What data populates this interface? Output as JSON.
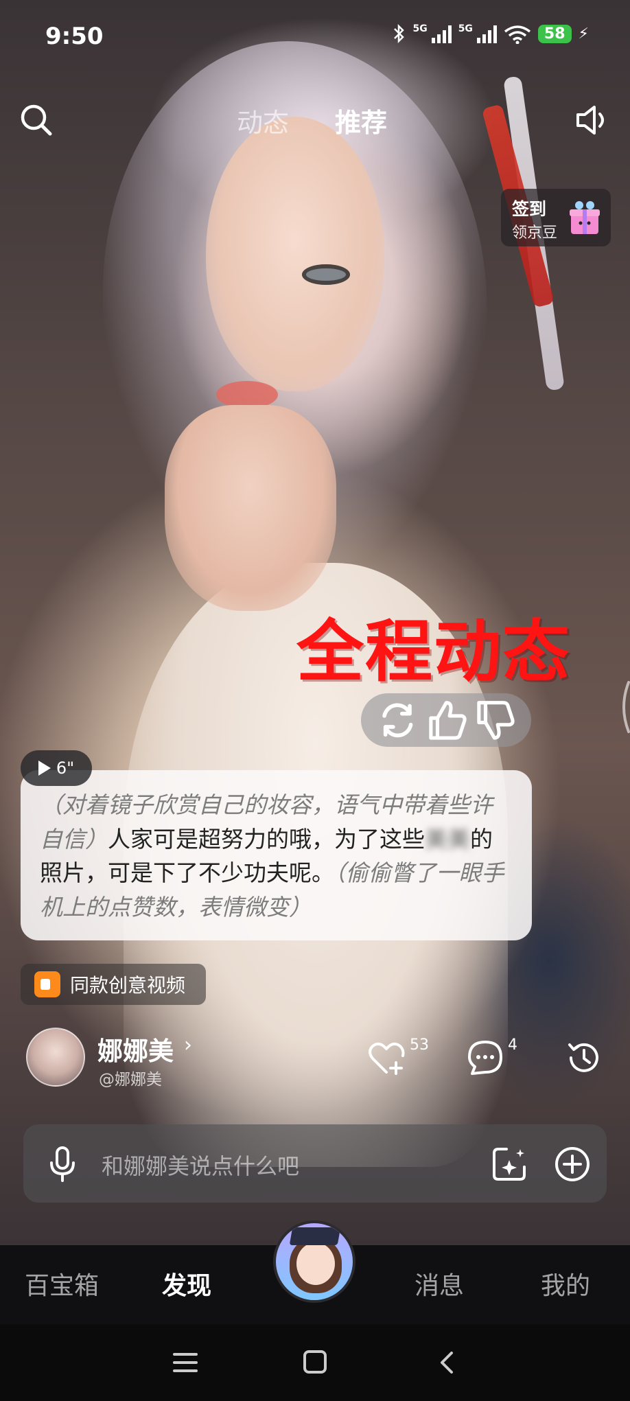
{
  "status_bar": {
    "time": "9:50",
    "network_1": "5G",
    "network_2": "5G",
    "battery": "58"
  },
  "top_tabs": {
    "dynamic": "动态",
    "recommend": "推荐"
  },
  "sign_in": {
    "title": "签到",
    "subtitle": "领京豆"
  },
  "overlay_title": "全程动态",
  "duration": "6\"",
  "caption": {
    "action_1": "（对着镜子欣赏自己的妆容，语气中带着些许自信）",
    "speech_1": "人家可是超努力的哦，为了这些",
    "blurred": "美美",
    "speech_2": "的照片，可是下了不少功夫呢。",
    "action_2": "（偷偷瞥了一眼手机上的点赞数，表情微变）"
  },
  "same_video_label": "同款创意视频",
  "profile": {
    "name": "娜娜美",
    "handle": "@娜娜美"
  },
  "stats": {
    "likes": "53",
    "comments": "4"
  },
  "input": {
    "placeholder": "和娜娜美说点什么吧"
  },
  "bottom_nav": {
    "items": [
      "百宝箱",
      "发现",
      "消息",
      "我的"
    ],
    "active": "发现"
  },
  "icons": {
    "search": "search-icon",
    "speaker": "speaker-icon",
    "refresh": "refresh-icon",
    "thumb_up": "thumbs-up-icon",
    "thumb_down": "thumbs-down-icon",
    "heart_plus": "heart-plus-icon",
    "comment": "comment-icon",
    "history": "history-icon",
    "mic": "mic-icon",
    "ai_image": "ai-image-icon",
    "plus_circle": "plus-circle-icon"
  },
  "colors": {
    "overlay_title": "#ff1414",
    "battery": "#3cc24a",
    "video_icon": "#ff8a1c"
  }
}
